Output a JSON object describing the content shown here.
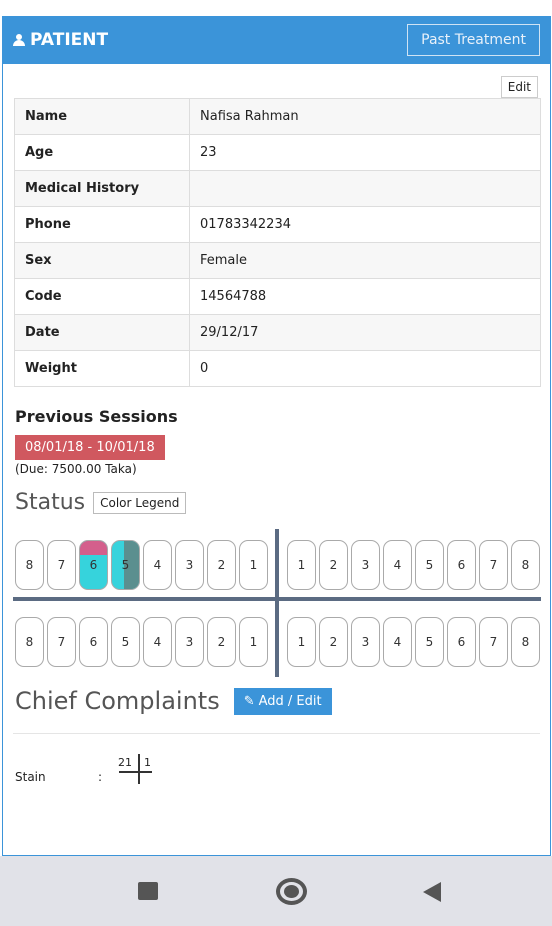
{
  "header": {
    "title": "PATIENT",
    "past_treatment": "Past Treatment",
    "accent": "#3b94d9"
  },
  "edit_label": "Edit",
  "patient": [
    {
      "key": "Name",
      "value": "Nafisa Rahman"
    },
    {
      "key": "Age",
      "value": "23"
    },
    {
      "key": "Medical History",
      "value": ""
    },
    {
      "key": "Phone",
      "value": "01783342234"
    },
    {
      "key": "Sex",
      "value": "Female"
    },
    {
      "key": "Code",
      "value": "14564788"
    },
    {
      "key": "Date",
      "value": "29/12/17"
    },
    {
      "key": "Weight",
      "value": "0"
    }
  ],
  "previous_sessions": {
    "title": "Previous Sessions",
    "session": "08/01/18 - 10/01/18",
    "due": "(Due: 7500.00 Taka)"
  },
  "status": {
    "title": "Status",
    "legend_label": "Color Legend"
  },
  "teeth": {
    "upper_left": [
      "8",
      "7",
      "6",
      "5",
      "4",
      "3",
      "2",
      "1"
    ],
    "upper_right": [
      "1",
      "2",
      "3",
      "4",
      "5",
      "6",
      "7",
      "8"
    ],
    "lower_left": [
      "8",
      "7",
      "6",
      "5",
      "4",
      "3",
      "2",
      "1"
    ],
    "lower_right": [
      "1",
      "2",
      "3",
      "4",
      "5",
      "6",
      "7",
      "8"
    ]
  },
  "chief_complaints": {
    "title": "Chief Complaints",
    "add_edit": "Add / Edit",
    "item_label": "Stain",
    "colon": ":",
    "quadrant_left": "21",
    "quadrant_right": "1"
  }
}
